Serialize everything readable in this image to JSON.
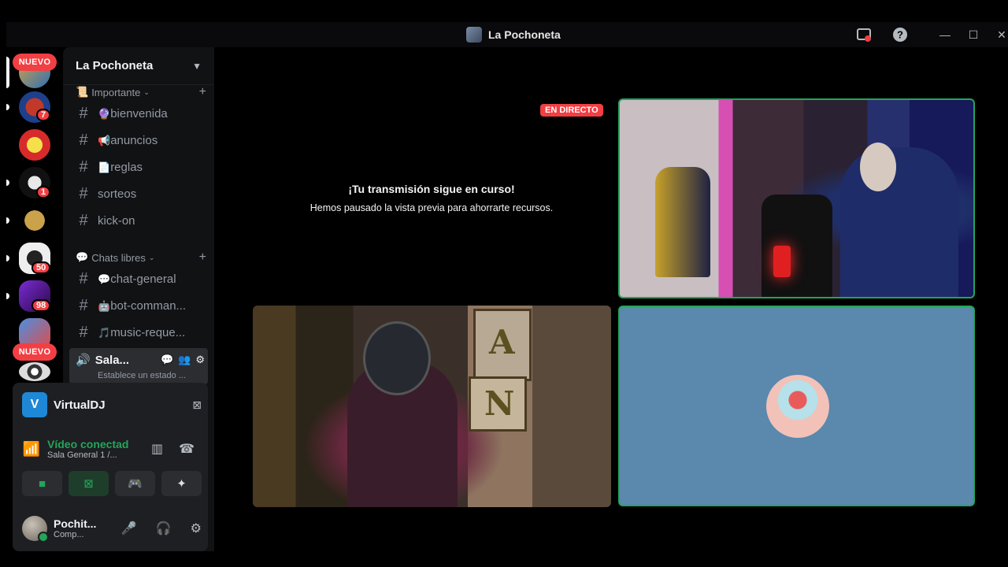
{
  "window": {
    "title": "La Pochoneta"
  },
  "rail": {
    "new_label": "NUEVO",
    "badges": [
      "7",
      "1",
      "50",
      "98"
    ],
    "server_icons": [
      "server-a-icon",
      "server-b-icon",
      "server-c-icon",
      "server-d-icon",
      "server-e-icon",
      "server-f-icon",
      "server-g-icon",
      "server-h-icon",
      "server-i-icon"
    ]
  },
  "sidebar": {
    "server_name": "La Pochoneta",
    "categories": [
      {
        "label": "Importante",
        "emoji": "📜"
      },
      {
        "label": "Chats libres",
        "emoji": "💬"
      }
    ],
    "channels": [
      {
        "emoji": "🔮",
        "name": "bienvenida"
      },
      {
        "emoji": "📢",
        "name": "anuncios"
      },
      {
        "emoji": "📄",
        "name": "reglas"
      },
      {
        "emoji": "",
        "name": "sorteos"
      },
      {
        "emoji": "",
        "name": "kick-on"
      },
      {
        "emoji": "💬",
        "name": "chat-general"
      },
      {
        "emoji": "🤖",
        "name": "bot-comman..."
      },
      {
        "emoji": "🎵",
        "name": "music-reque..."
      }
    ],
    "voice_channel": {
      "name": "Sala...",
      "status": "Establece un estado ..."
    }
  },
  "panel": {
    "app_name": "VirtualDJ",
    "app_logo": "V",
    "voice_status": "Vídeo conectad",
    "voice_location": "Sala General 1 /...",
    "user_name": "Pochit...",
    "user_status": "Comp..."
  },
  "stage": {
    "live_label": "EN DIRECTO",
    "paused_title": "¡Tu transmisión sigue en curso!",
    "paused_subtitle": "Hemos pausado la vista previa para ahorrarte recursos.",
    "sign_letters": [
      "A",
      "N"
    ]
  },
  "colors": {
    "accent_green": "#23a55a",
    "badge_red": "#f23f43",
    "audio_tile_bg": "#5b88ad"
  }
}
